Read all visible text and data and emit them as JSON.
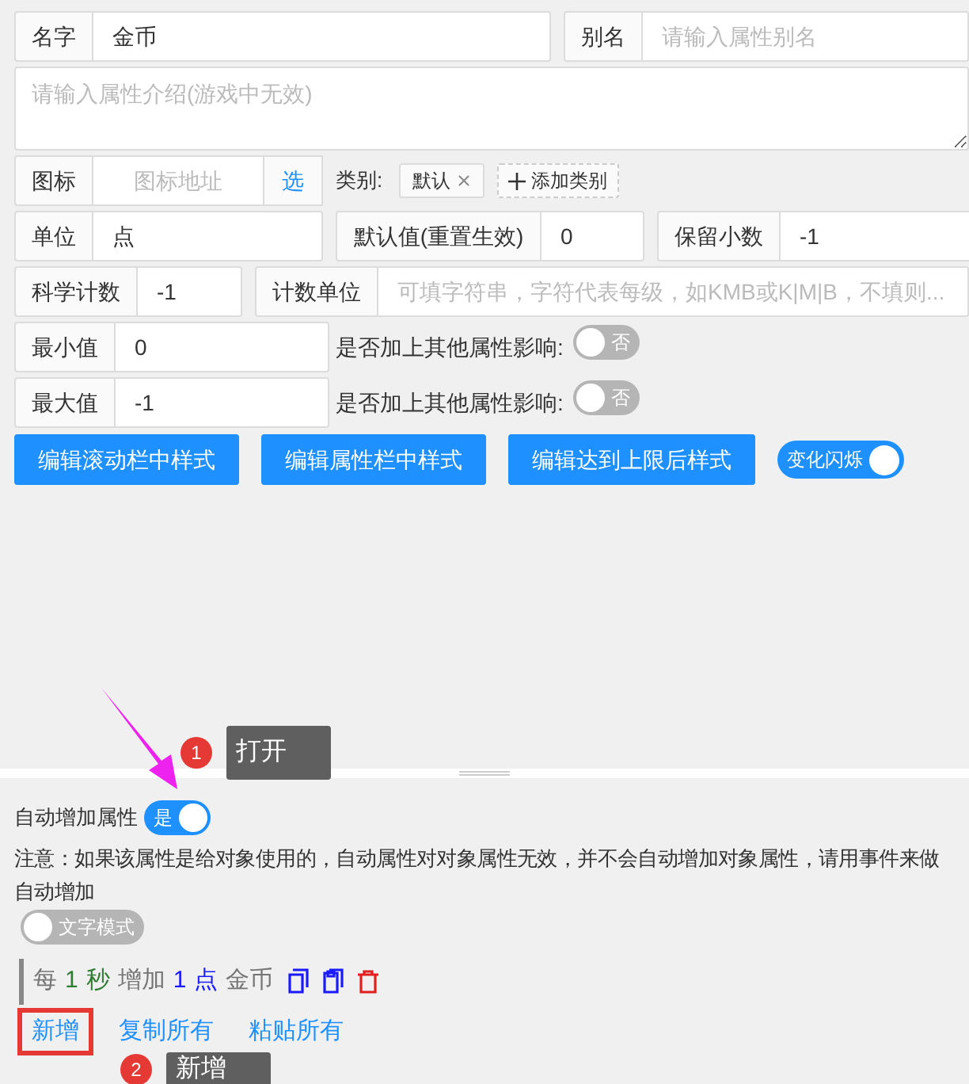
{
  "name_field": {
    "label": "名字",
    "value": "金币"
  },
  "alias_field": {
    "label": "别名",
    "placeholder": "请输入属性别名"
  },
  "description": {
    "placeholder": "请输入属性介绍(游戏中无效)"
  },
  "icon_field": {
    "label": "图标",
    "placeholder": "图标地址",
    "pick": "选"
  },
  "category": {
    "label": "类别:",
    "tags": [
      "默认"
    ],
    "add": "添加类别"
  },
  "row_4": [
    {
      "label": "单位",
      "value": "点"
    },
    {
      "label": "默认值(重置生效)",
      "value": "0"
    },
    {
      "label": "保留小数",
      "value": "-1"
    }
  ],
  "row_5": [
    {
      "label": "科学计数",
      "value": "-1"
    },
    {
      "label": "计数单位",
      "placeholder": "可填字符串，字符代表每级，如KMB或K|M|B，不填则..."
    }
  ],
  "limits": [
    {
      "label": "最小值",
      "value": "0",
      "question": "是否加上其他属性影响:",
      "on": false,
      "switch_text": "否"
    },
    {
      "label": "最大值",
      "value": "-1",
      "question": "是否加上其他属性影响:",
      "on": false,
      "switch_text": "否"
    }
  ],
  "style_buttons": [
    "编辑滚动栏中样式",
    "编辑属性栏中样式",
    "编辑达到上限后样式"
  ],
  "flash_toggle": {
    "label": "变化闪烁",
    "on": true
  },
  "auto_increase": {
    "label": "自动增加属性",
    "on": true,
    "switch_text": "是"
  },
  "note": "注意：如果该属性是给对象使用的，自动属性对对象属性无效，并不会自动增加对象属性，请用事件来做自动增加",
  "text_mode": {
    "label": "文字模式",
    "on": false
  },
  "rules": [
    {
      "parts": [
        {
          "text": "每",
          "color": "#757575"
        },
        {
          "text": "1",
          "color": "#2e7d32"
        },
        {
          "text": "秒",
          "color": "#2e7d32"
        },
        {
          "text": "增加",
          "color": "#757575"
        },
        {
          "text": "1",
          "color": "#1a1aff"
        },
        {
          "text": "点",
          "color": "#1a1aff"
        },
        {
          "text": "金币",
          "color": "#757575"
        }
      ]
    }
  ],
  "links": [
    {
      "text": "新增",
      "highlighted": true
    },
    {
      "text": "复制所有",
      "highlighted": false
    },
    {
      "text": "粘贴所有",
      "highlighted": false
    }
  ],
  "annotations": [
    {
      "number": "1",
      "text": "打开"
    },
    {
      "number": "2",
      "text": "新增"
    }
  ]
}
